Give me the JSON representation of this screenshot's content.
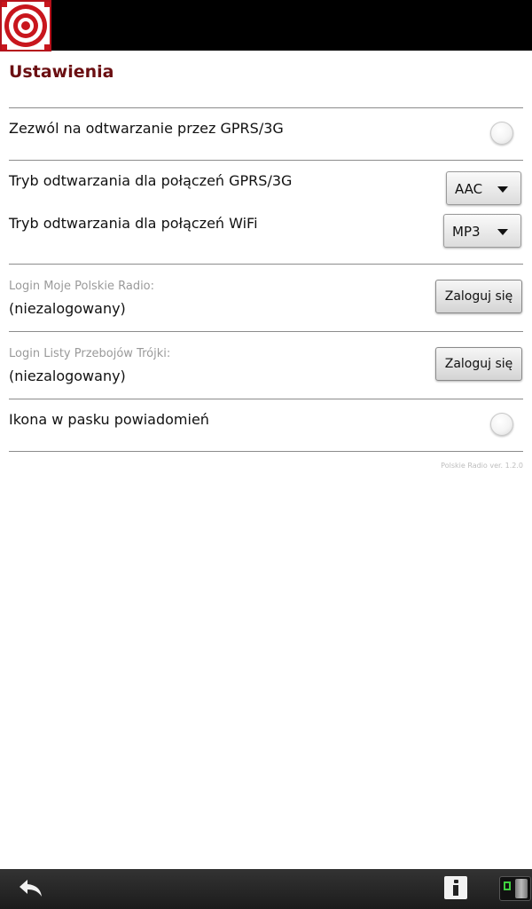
{
  "header": {
    "logo_icon": "polskie-radio-logo-icon"
  },
  "settings": {
    "title": "Ustawienia",
    "gprs_toggle_label": "Zezwól na odtwarzanie przez GPRS/3G",
    "gprs_mode_label": "Tryb odtwarzania dla połączeń GPRS/3G",
    "gprs_mode_value": "AAC",
    "wifi_mode_label": "Tryb odtwarzania dla połączeń WiFi",
    "wifi_mode_value": "MP3",
    "moje_login_label": "Login Moje Polskie Radio:",
    "moje_login_status": "(niezalogowany)",
    "moje_login_button": "Zaloguj się",
    "trojka_login_label": "Login Listy Przebojów Trójki:",
    "trojka_login_status": "(niezalogowany)",
    "trojka_login_button": "Zaloguj się",
    "notification_icon_label": "Ikona w pasku powiadomień",
    "version": "Polskie Radio ver. 1.2.0"
  },
  "navbar": {
    "back_icon": "back-arrow-icon",
    "info_icon": "info-icon",
    "status_icon": "connection-status-icon"
  },
  "colors": {
    "title": "#6b0f12",
    "logo_red": "#b5121b"
  }
}
